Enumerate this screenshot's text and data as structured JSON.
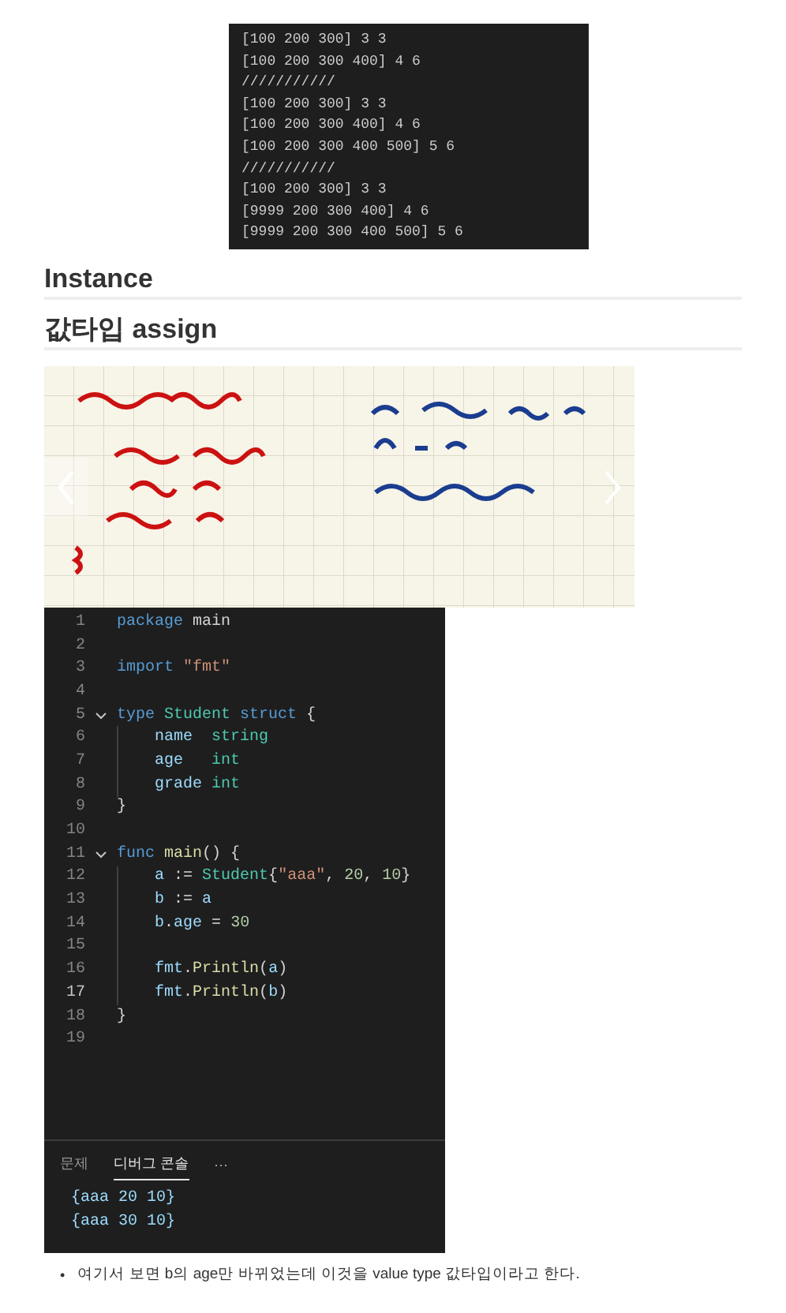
{
  "console_output": {
    "lines": [
      "[100 200 300] 3 3",
      "[100 200 300 400] 4 6",
      "///////////",
      "[100 200 300] 3 3",
      "[100 200 300 400] 4 6",
      "[100 200 300 400 500] 5 6",
      "///////////",
      "[100 200 300] 3 3",
      "[9999 200 300 400] 4 6",
      "[9999 200 300 400 500] 5 6"
    ]
  },
  "headings": [
    "Instance",
    "값타입 assign"
  ],
  "carousel": {
    "image": {
      "kind": "picture"
    }
  },
  "editor": {
    "lines": [
      {
        "number": "1",
        "tokens": [
          {
            "kind": "kw",
            "text": "package"
          },
          {
            "kind": "plain",
            "text": " main"
          }
        ]
      },
      {
        "number": "2"
      },
      {
        "number": "3",
        "tokens": [
          {
            "kind": "kw",
            "text": "import"
          },
          {
            "kind": "str",
            "text": " \"fmt\""
          }
        ]
      },
      {
        "number": "4"
      },
      {
        "number": "5",
        "fold": true,
        "tokens": [
          {
            "kind": "kw",
            "text": "type"
          },
          {
            "kind": "type",
            "text": " Student"
          },
          {
            "kind": "kw",
            "text": " struct"
          },
          {
            "kind": "plain",
            "text": " {"
          }
        ],
        "children": [
          {
            "number": "6",
            "tokens": [
              {
                "kind": "var",
                "text": "name"
              },
              {
                "kind": "type",
                "text": "  string"
              }
            ]
          },
          {
            "number": "7",
            "tokens": [
              {
                "kind": "var",
                "text": "age"
              },
              {
                "kind": "type",
                "text": "   int"
              }
            ]
          },
          {
            "number": "8",
            "tokens": [
              {
                "kind": "var",
                "text": "grade"
              },
              {
                "kind": "type",
                "text": " int"
              }
            ]
          }
        ]
      },
      {
        "number": "9",
        "tokens": [
          {
            "kind": "plain",
            "text": "}"
          }
        ]
      },
      {
        "number": "10"
      },
      {
        "number": "11",
        "fold": true,
        "tokens": [
          {
            "kind": "kw",
            "text": "func"
          },
          {
            "kind": "func",
            "text": " main"
          },
          {
            "kind": "plain",
            "text": "() {"
          }
        ],
        "children": [
          {
            "number": "12",
            "tokens": [
              {
                "kind": "var",
                "text": "a"
              },
              {
                "kind": "plain",
                "text": " := "
              },
              {
                "kind": "type",
                "text": "Student"
              },
              {
                "kind": "plain",
                "text": "{"
              },
              {
                "kind": "str",
                "text": "\"aaa\""
              },
              {
                "kind": "plain",
                "text": ", "
              },
              {
                "kind": "num",
                "text": "20"
              },
              {
                "kind": "plain",
                "text": ", "
              },
              {
                "kind": "num",
                "text": "10"
              },
              {
                "kind": "plain",
                "text": "}"
              }
            ]
          },
          {
            "number": "13",
            "tokens": [
              {
                "kind": "var",
                "text": "b"
              },
              {
                "kind": "plain",
                "text": " := "
              },
              {
                "kind": "var",
                "text": "a"
              }
            ]
          },
          {
            "number": "14",
            "tokens": [
              {
                "kind": "var",
                "text": "b"
              },
              {
                "kind": "plain",
                "text": "."
              },
              {
                "kind": "var",
                "text": "age"
              },
              {
                "kind": "plain",
                "text": " = "
              },
              {
                "kind": "num",
                "text": "30"
              }
            ]
          },
          {
            "number": "15"
          },
          {
            "number": "16",
            "tokens": [
              {
                "kind": "var",
                "text": "fmt"
              },
              {
                "kind": "plain",
                "text": "."
              },
              {
                "kind": "func",
                "text": "Println"
              },
              {
                "kind": "plain",
                "text": "("
              },
              {
                "kind": "var",
                "text": "a"
              },
              {
                "kind": "plain",
                "text": ")"
              }
            ]
          },
          {
            "number": "17",
            "current": true,
            "tokens": [
              {
                "kind": "var",
                "text": "fmt"
              },
              {
                "kind": "plain",
                "text": "."
              },
              {
                "kind": "func",
                "text": "Println"
              },
              {
                "kind": "plain",
                "text": "("
              },
              {
                "kind": "var",
                "text": "b"
              },
              {
                "kind": "plain",
                "text": ")"
              }
            ]
          }
        ]
      },
      {
        "number": "18",
        "tokens": [
          {
            "kind": "plain",
            "text": "}"
          }
        ]
      },
      {
        "number": "19"
      }
    ]
  },
  "panel": {
    "tabs": [
      {
        "label": "문제",
        "selected": false
      },
      {
        "label": "디버그 콘솔",
        "selected": true
      }
    ],
    "more": "···",
    "output": [
      "{aaa 20 10}",
      "{aaa 30 10}"
    ]
  },
  "bullets": [
    {
      "marker": "•",
      "text": "여기서 보면 b의 age만 바뀌었는데 이것을 value type 값타입이라고 한다."
    }
  ]
}
